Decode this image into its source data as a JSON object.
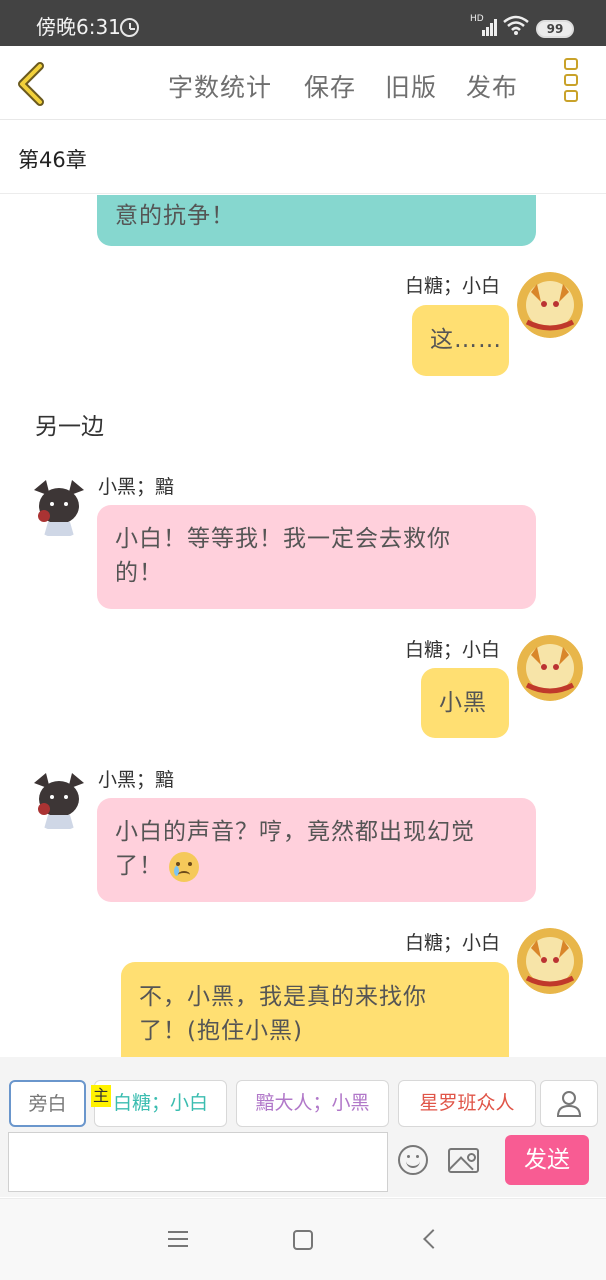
{
  "status_bar": {
    "time": "傍晚6:31",
    "network": "HD",
    "battery": "99"
  },
  "toolbar": {
    "word_count": "字数统计",
    "save": "保存",
    "old_version": "旧版",
    "publish": "发布"
  },
  "chapter": {
    "title": "第46章"
  },
  "messages": [
    {
      "text": "意的抗争！",
      "color": "#86d7cf"
    },
    {
      "speaker": "白糖；小白",
      "text": "这……",
      "color": "#ffdf72"
    },
    {
      "narration": "另一边"
    },
    {
      "speaker": "小黑；黯",
      "line1": "小白！等等我！我一定会去救你",
      "line2": "的！",
      "color": "#ffd0dc"
    },
    {
      "speaker": "白糖；小白",
      "text": "小黑",
      "color": "#ffdf72"
    },
    {
      "speaker": "小黑；黯",
      "line1": "小白的声音？哼，竟然都出现幻觉",
      "line2": "了！",
      "emoji": "crying-face",
      "color": "#ffd0dc"
    },
    {
      "speaker": "白糖；小白",
      "line1": "不，小黑，我是真的来找你",
      "line2": "了！(抱住小黑)",
      "color": "#ffdf72"
    }
  ],
  "roles": {
    "narrator": "旁白",
    "main_tag": "主",
    "role1": "白糖；小白",
    "role2": "黯大人；小黑",
    "role3": "星罗班众人"
  },
  "input": {
    "value": "",
    "send_label": "发送"
  },
  "colors": {
    "accent_yellow": "#ffdf72",
    "accent_pink": "#ffd0dc",
    "accent_teal": "#86d7cf",
    "send": "#f85c93",
    "role1_text": "#3bbdb0",
    "role2_text": "#b178c9",
    "role3_text": "#e05548"
  }
}
